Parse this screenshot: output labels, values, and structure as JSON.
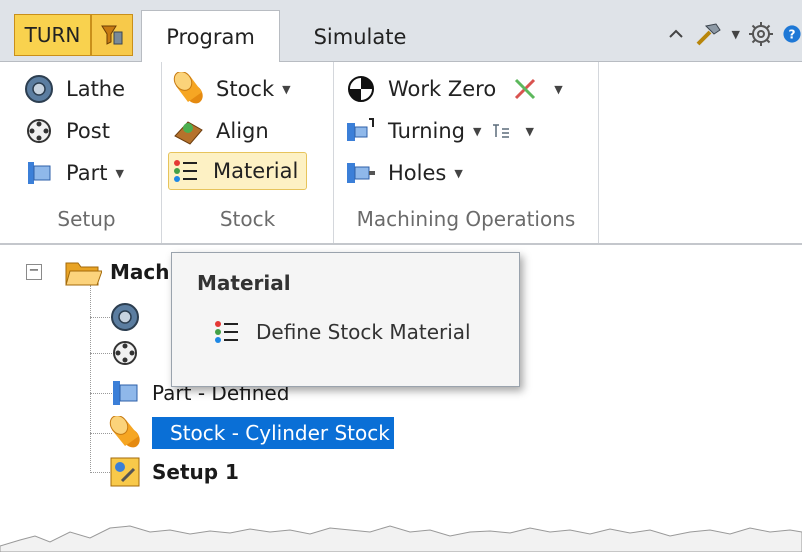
{
  "tabbar": {
    "turn_label": "TURN",
    "tabs": [
      {
        "label": "Program",
        "active": true
      },
      {
        "label": "Simulate",
        "active": false
      }
    ],
    "right_icons": [
      "collapse-ribbon-icon",
      "hammer-tools-icon",
      "settings-gear-icon",
      "help-icon"
    ]
  },
  "ribbon": {
    "groups": [
      {
        "label": "Setup",
        "buttons": [
          {
            "label": "Lathe",
            "icon": "lathe-icon"
          },
          {
            "label": "Post",
            "icon": "post-icon"
          },
          {
            "label": "Part",
            "icon": "part-icon",
            "dropdown": true
          }
        ]
      },
      {
        "label": "Stock",
        "buttons": [
          {
            "label": "Stock",
            "icon": "stock-cylinder-icon",
            "dropdown": true
          },
          {
            "label": "Align",
            "icon": "align-icon"
          },
          {
            "label": "Material",
            "icon": "material-icon",
            "active": true
          }
        ]
      },
      {
        "label": "Machining Operations",
        "buttons": [
          {
            "label": "Work Zero",
            "icon": "work-zero-icon"
          },
          {
            "label": "Turning",
            "icon": "turning-icon",
            "dropdown": true
          },
          {
            "label": "Holes",
            "icon": "holes-icon",
            "dropdown": true
          }
        ]
      }
    ]
  },
  "tree": {
    "root_label": "Mach",
    "items": [
      {
        "label": "",
        "icon": "lathe-icon"
      },
      {
        "label": "",
        "icon": "post-icon"
      },
      {
        "label": "Part - Defined",
        "icon": "part-icon"
      },
      {
        "label": "Stock - Cylinder Stock",
        "icon": "stock-cylinder-icon",
        "selected": true
      },
      {
        "label": "Setup 1",
        "icon": "setup-icon",
        "bold": true
      }
    ]
  },
  "tooltip": {
    "title": "Material",
    "item_label": "Define Stock Material"
  },
  "colors": {
    "accent_yellow": "#f9d24e",
    "selection_blue": "#0a6fd6",
    "ribbon_bg": "#ffffff",
    "tabbar_bg": "#dfe3e8"
  }
}
